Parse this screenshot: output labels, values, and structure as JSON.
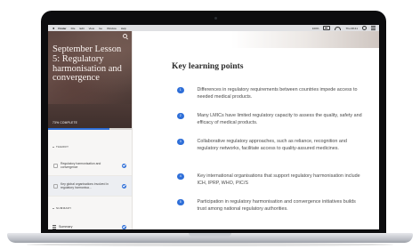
{
  "menubar": {
    "app_name": "Finder",
    "items": [
      "File",
      "Edit",
      "View",
      "Go",
      "Window",
      "Help"
    ],
    "battery_text": "100%",
    "clock": "Thu 08:41"
  },
  "sidebar": {
    "title": "September Lesson 5: Regulatory harmonisation and convergence",
    "status": "73% COMPLETE",
    "progress_percent": 73,
    "sections": {
      "theory": "THEORY",
      "summary": "SUMMARY"
    },
    "lessons": [
      {
        "label": "Regulatory harmonisation and convergence"
      },
      {
        "label": "Key global organisations involved in regulatory harmonisa..."
      }
    ],
    "summary_item": "Summary"
  },
  "main": {
    "heading": "Key learning points",
    "points": [
      {
        "num": "1",
        "text": "Differences in regulatory requirements between countries impede access to needed medical products."
      },
      {
        "num": "2",
        "text": "Many LMICs have limited regulatory capacity to assess the quality, safety and efficacy of medical products."
      },
      {
        "num": "3",
        "text": "Collaborative regulatory approaches, such as reliance, recognition and regulatory networks, facilitate access to quality-assured medicines."
      },
      {
        "num": "4",
        "text": "Key international organisations that support regulatory harmonisation include ICH, IPRP, WHO, PIC/S"
      },
      {
        "num": "5",
        "text": "Participation in regulatory harmonisation and convergence initiatives builds trust among national regulatory authorities."
      }
    ]
  },
  "colors": {
    "accent": "#2f6fd8",
    "hero": "#5d4641"
  }
}
